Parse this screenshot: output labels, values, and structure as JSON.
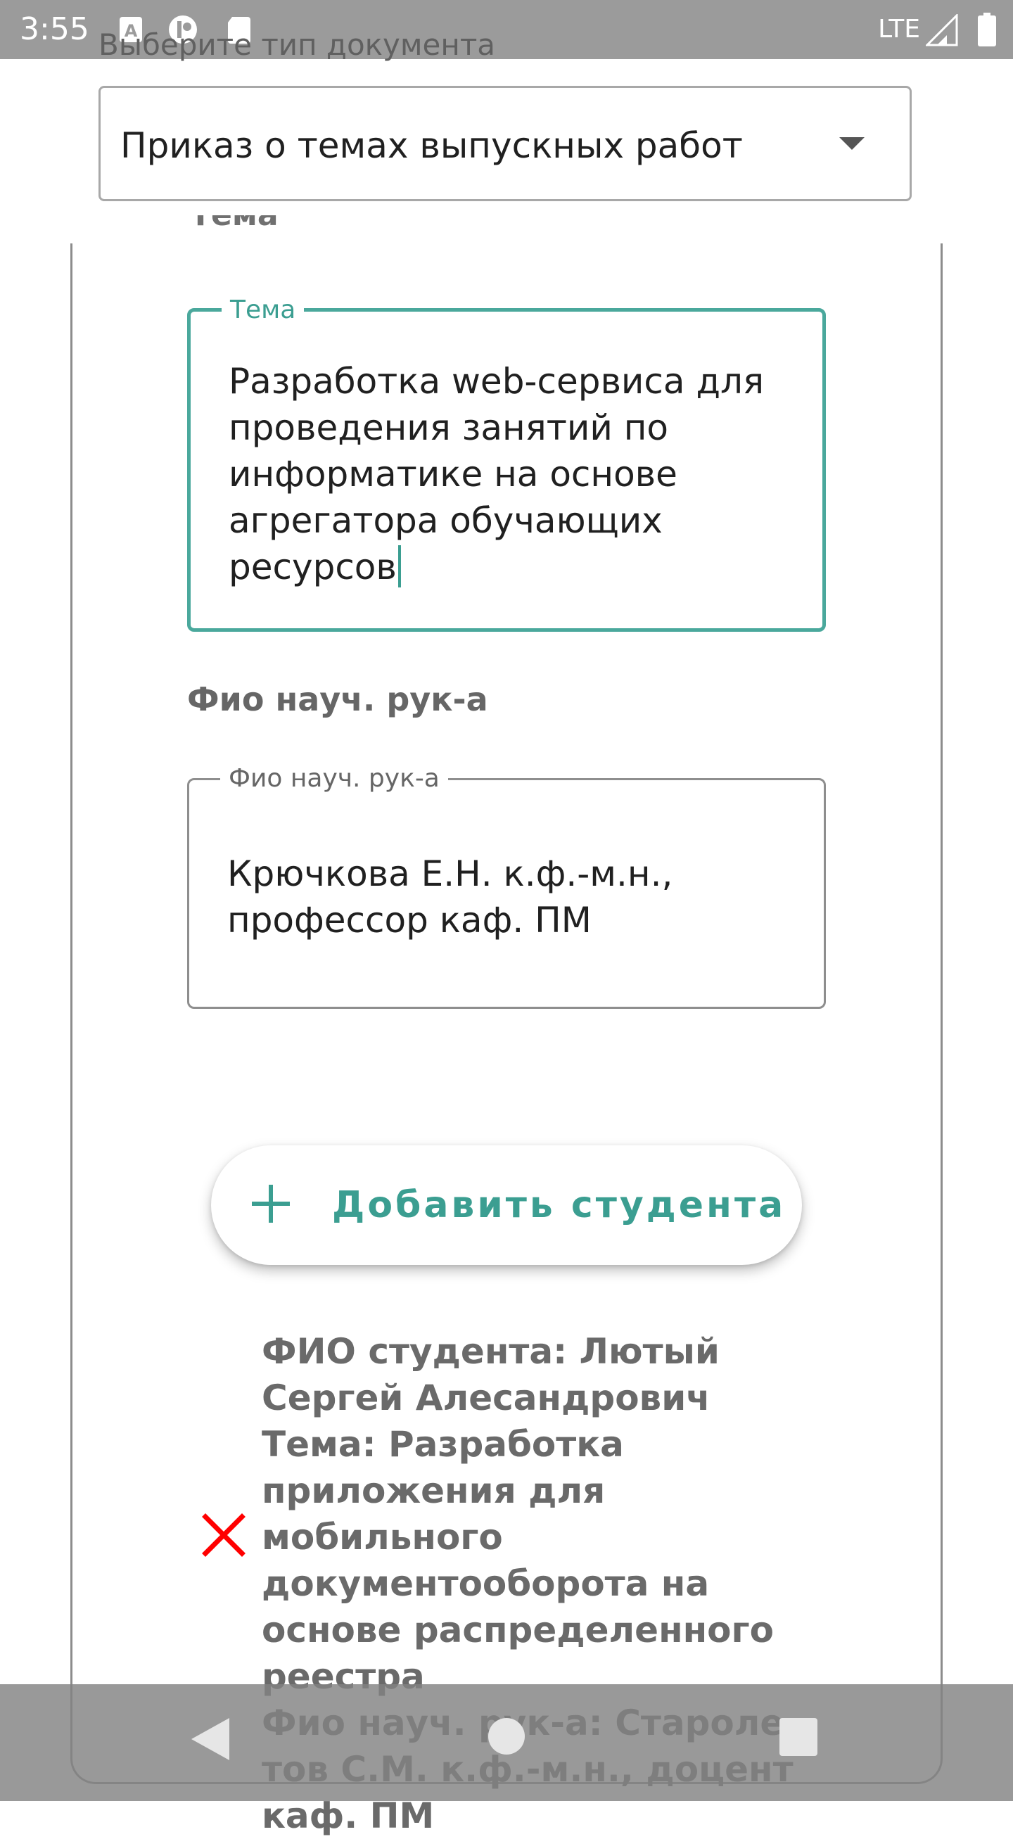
{
  "status_bar": {
    "time": "3:55",
    "network": "LTE",
    "icons": [
      "text-a-icon",
      "app-notification-icon",
      "sd-card-icon",
      "signal-icon",
      "battery-icon"
    ]
  },
  "document": {
    "type_label": "Выберите тип документа",
    "selected_type": "Приказ о темах выпускных работ"
  },
  "form": {
    "topic_section_label_cut": "Тема",
    "topic_field": {
      "legend": "Тема",
      "value": "Разработка web-сервиса для проведения занятий по информатике на основе агрегатора обучающих ресурсов"
    },
    "supervisor_section_label": "Фио науч. рук-а",
    "supervisor_field": {
      "legend": "Фио науч. рук-а",
      "value": "Крючкова Е.Н. к.ф.-м.н., профессор каф. ПМ"
    },
    "add_student_label": "Добавить студента"
  },
  "students": [
    {
      "name_line": "ФИО студента: Лютый Сергей Алесандрович",
      "topic_line": "Тема: Разработка приложения для мобильного документооборота на основе распределенного реестра",
      "supervisor_line": "Фио науч. рук-а: Староле­тов С.М. к.ф.-м.н., доцент каф. ПМ"
    }
  ],
  "colors": {
    "accent": "#3b9e91",
    "status_bar": "#9b9b9b",
    "remove_icon": "#ff0000"
  }
}
